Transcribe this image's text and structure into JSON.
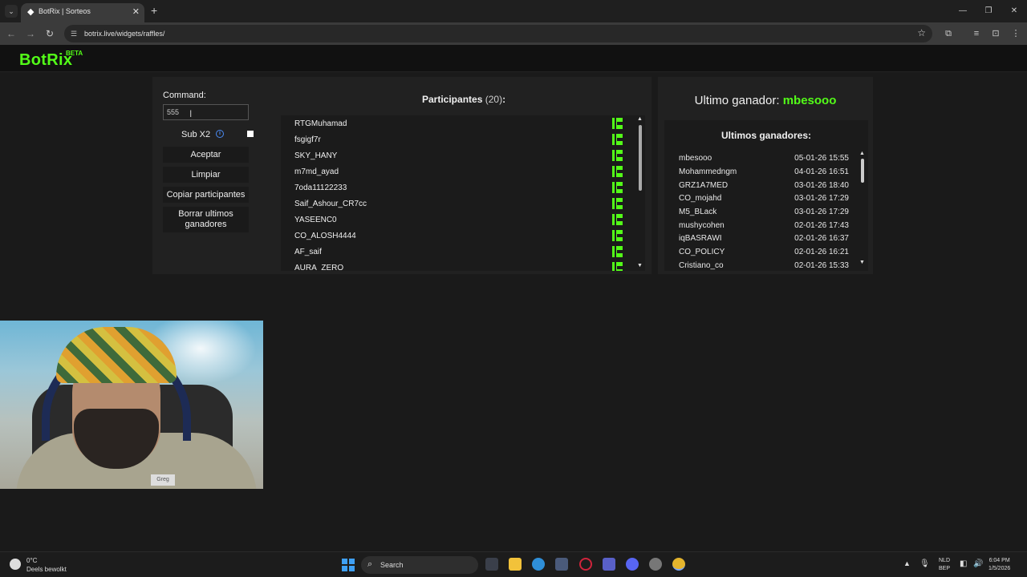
{
  "browser": {
    "tab_title": "BotRix | Sorteos",
    "url": "botrix.live/widgets/raffles/"
  },
  "site": {
    "logo": "BotRix",
    "beta": "BETA"
  },
  "controls": {
    "command_label": "Command:",
    "command_value": "555",
    "sub_label": "Sub X2",
    "sub_checked": false,
    "buttons": [
      {
        "label": "Aceptar"
      },
      {
        "label": "Limpiar"
      },
      {
        "label": "Copiar participantes"
      },
      {
        "label": "Borrar ultimos ganadores"
      }
    ]
  },
  "participants": {
    "title": "Participantes",
    "count": "(20)",
    "colon": ":",
    "list": [
      "RTGMuhamad",
      "fsgigf7r",
      "SKY_HANY",
      "m7md_ayad",
      "7oda11122233",
      "Saif_Ashour_CR7cc",
      "YASEENC0",
      "CO_ALOSH4444",
      "AF_saif",
      "AURA_ZERO"
    ]
  },
  "winner": {
    "label": "Ultimo ganador:",
    "name": "mbesooo",
    "history_title": "Ultimos ganadores:",
    "history": [
      {
        "name": "mbesooo",
        "date": "05-01-26 15:55"
      },
      {
        "name": "Mohammedngm",
        "date": "04-01-26 16:51"
      },
      {
        "name": "GRZ1A7MED",
        "date": "03-01-26 18:40"
      },
      {
        "name": "CO_mojahd",
        "date": "03-01-26 17:29"
      },
      {
        "name": "M5_BLack",
        "date": "03-01-26 17:29"
      },
      {
        "name": "mushycohen",
        "date": "02-01-26 17:43"
      },
      {
        "name": "iqBASRAWI",
        "date": "02-01-26 16:37"
      },
      {
        "name": "CO_POLICY",
        "date": "02-01-26 16:21"
      },
      {
        "name": "Cristiano_co",
        "date": "02-01-26 15:33"
      }
    ]
  },
  "webcam": {
    "shirt_logo": "Greg"
  },
  "taskbar": {
    "temperature": "0°C",
    "weather": "Deels bewolkt",
    "search_placeholder": "Search",
    "lang_top": "NLD",
    "lang_bottom": "BEP",
    "time": "6:04 PM",
    "date": "1/5/2026"
  },
  "colors": {
    "accent": "#53fc18",
    "background": "#1a1a1a",
    "panel": "#212121"
  }
}
